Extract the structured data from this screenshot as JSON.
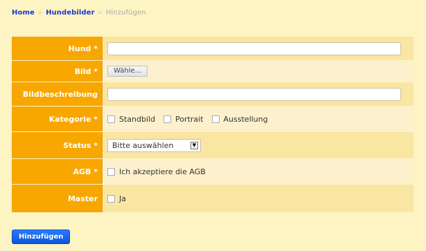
{
  "breadcrumb": {
    "items": [
      "Home",
      "Hundebilder"
    ],
    "separator": "»",
    "current": "Hinzufügen"
  },
  "form": {
    "hund": {
      "label": "Hund *",
      "value": ""
    },
    "bild": {
      "label": "Bild *",
      "button": "Wähle..."
    },
    "bildbeschreibung": {
      "label": "Bildbeschreibung",
      "value": ""
    },
    "kategorie": {
      "label": "Kategorie *",
      "options": [
        "Standbild",
        "Portrait",
        "Ausstellung"
      ]
    },
    "status": {
      "label": "Status *",
      "selected": "Bitte auswählen"
    },
    "agb": {
      "label": "AGB *",
      "checkbox_label": "Ich akzeptiere die AGB"
    },
    "master": {
      "label": "Master",
      "checkbox_label": "Ja"
    }
  },
  "submit_label": "Hinzufügen",
  "colors": {
    "background": "#fdf4c4",
    "label_bg": "#f7a700",
    "link": "#1f35c9",
    "button": "#0a56d6"
  }
}
